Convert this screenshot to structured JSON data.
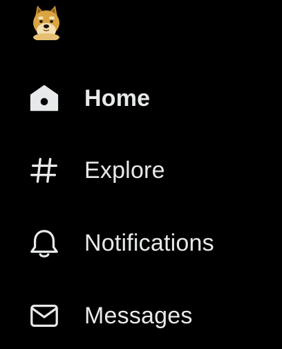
{
  "logo": {
    "icon": "doge-icon"
  },
  "nav": {
    "items": [
      {
        "label": "Home",
        "icon": "home-icon",
        "active": true
      },
      {
        "label": "Explore",
        "icon": "hashtag-icon",
        "active": false
      },
      {
        "label": "Notifications",
        "icon": "bell-icon",
        "active": false
      },
      {
        "label": "Messages",
        "icon": "envelope-icon",
        "active": false
      }
    ]
  },
  "colors": {
    "background": "#000000",
    "text": "#e7e9ea",
    "logo_fur": "#d9a441",
    "logo_light": "#f3dfb0"
  }
}
